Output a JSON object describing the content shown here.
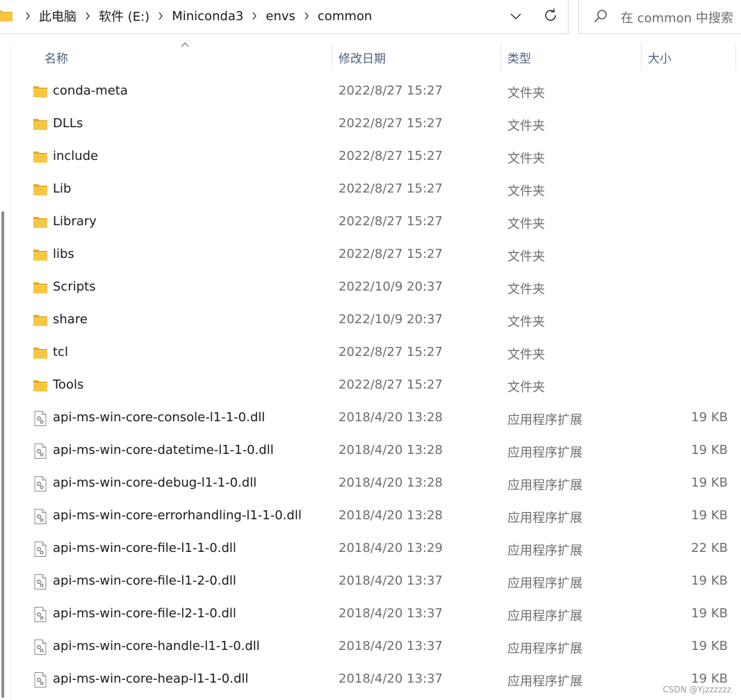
{
  "address_bar": {
    "crumbs": [
      "此电脑",
      "软件 (E:)",
      "Miniconda3",
      "envs",
      "common"
    ]
  },
  "search": {
    "placeholder": "在 common 中搜索"
  },
  "columns": {
    "name": "名称",
    "date": "修改日期",
    "type": "类型",
    "size": "大小"
  },
  "rows": [
    {
      "name": "conda-meta",
      "date": "2022/8/27 15:27",
      "type": "文件夹",
      "size": "",
      "icon": "folder-icon"
    },
    {
      "name": "DLLs",
      "date": "2022/8/27 15:27",
      "type": "文件夹",
      "size": "",
      "icon": "folder-icon"
    },
    {
      "name": "include",
      "date": "2022/8/27 15:27",
      "type": "文件夹",
      "size": "",
      "icon": "folder-icon"
    },
    {
      "name": "Lib",
      "date": "2022/8/27 15:27",
      "type": "文件夹",
      "size": "",
      "icon": "folder-icon"
    },
    {
      "name": "Library",
      "date": "2022/8/27 15:27",
      "type": "文件夹",
      "size": "",
      "icon": "folder-icon"
    },
    {
      "name": "libs",
      "date": "2022/8/27 15:27",
      "type": "文件夹",
      "size": "",
      "icon": "folder-icon"
    },
    {
      "name": "Scripts",
      "date": "2022/10/9 20:37",
      "type": "文件夹",
      "size": "",
      "icon": "folder-icon"
    },
    {
      "name": "share",
      "date": "2022/10/9 20:37",
      "type": "文件夹",
      "size": "",
      "icon": "folder-icon"
    },
    {
      "name": "tcl",
      "date": "2022/8/27 15:27",
      "type": "文件夹",
      "size": "",
      "icon": "folder-icon"
    },
    {
      "name": "Tools",
      "date": "2022/8/27 15:27",
      "type": "文件夹",
      "size": "",
      "icon": "folder-icon"
    },
    {
      "name": "api-ms-win-core-console-l1-1-0.dll",
      "date": "2018/4/20 13:28",
      "type": "应用程序扩展",
      "size": "19 KB",
      "icon": "dll-file-icon"
    },
    {
      "name": "api-ms-win-core-datetime-l1-1-0.dll",
      "date": "2018/4/20 13:28",
      "type": "应用程序扩展",
      "size": "19 KB",
      "icon": "dll-file-icon"
    },
    {
      "name": "api-ms-win-core-debug-l1-1-0.dll",
      "date": "2018/4/20 13:28",
      "type": "应用程序扩展",
      "size": "19 KB",
      "icon": "dll-file-icon"
    },
    {
      "name": "api-ms-win-core-errorhandling-l1-1-0.dll",
      "date": "2018/4/20 13:28",
      "type": "应用程序扩展",
      "size": "19 KB",
      "icon": "dll-file-icon"
    },
    {
      "name": "api-ms-win-core-file-l1-1-0.dll",
      "date": "2018/4/20 13:29",
      "type": "应用程序扩展",
      "size": "22 KB",
      "icon": "dll-file-icon"
    },
    {
      "name": "api-ms-win-core-file-l1-2-0.dll",
      "date": "2018/4/20 13:37",
      "type": "应用程序扩展",
      "size": "19 KB",
      "icon": "dll-file-icon"
    },
    {
      "name": "api-ms-win-core-file-l2-1-0.dll",
      "date": "2018/4/20 13:37",
      "type": "应用程序扩展",
      "size": "19 KB",
      "icon": "dll-file-icon"
    },
    {
      "name": "api-ms-win-core-handle-l1-1-0.dll",
      "date": "2018/4/20 13:37",
      "type": "应用程序扩展",
      "size": "19 KB",
      "icon": "dll-file-icon"
    },
    {
      "name": "api-ms-win-core-heap-l1-1-0.dll",
      "date": "2018/4/20 13:37",
      "type": "应用程序扩展",
      "size": "19 KB",
      "icon": "dll-file-icon"
    }
  ],
  "watermark": "CSDN @Yjzzzzzz",
  "colors": {
    "folder": "#f8c640",
    "folder_dark": "#e8a92a",
    "header_text": "#4c607a",
    "secondary_text": "#6d6d6d"
  }
}
